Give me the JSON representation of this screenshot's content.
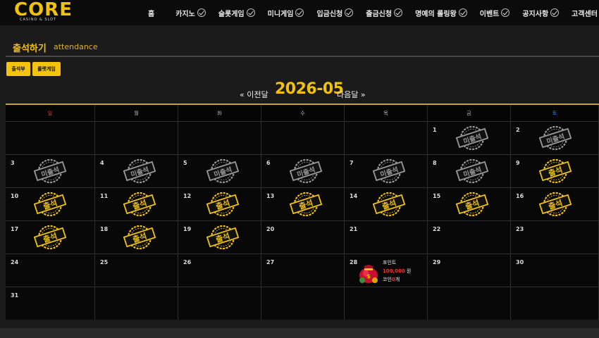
{
  "header": {
    "logo_text": "CORE",
    "logo_sub": "CASINO & SLOT",
    "nav": [
      {
        "label": "홈",
        "check": false,
        "gap": 0
      },
      {
        "label": "카지노",
        "check": true
      },
      {
        "label": "슬롯게임",
        "check": true
      },
      {
        "label": "미니게임",
        "check": true
      },
      {
        "label": "입금신청",
        "check": true
      },
      {
        "label": "출금신청",
        "check": true
      },
      {
        "label": "명예의 롤링왕",
        "check": true
      },
      {
        "label": "이벤트",
        "check": true
      },
      {
        "label": "공지사항",
        "check": true
      },
      {
        "label": "고객센터",
        "check": true
      }
    ]
  },
  "page": {
    "title": "출석하기",
    "subtitle": "attendance",
    "buttons": [
      "출석부",
      "룰렛게임"
    ]
  },
  "month_nav": {
    "prev": "« 이전달",
    "month": "2026-05",
    "next": "다음달 »"
  },
  "calendar": {
    "weekdays": [
      {
        "label": "일",
        "color": "#ff2a2a"
      },
      {
        "label": "월",
        "color": "#bbbbbb"
      },
      {
        "label": "화",
        "color": "#bbbbbb"
      },
      {
        "label": "수",
        "color": "#bbbbbb"
      },
      {
        "label": "목",
        "color": "#bbbbbb"
      },
      {
        "label": "금",
        "color": "#bbbbbb"
      },
      {
        "label": "토",
        "color": "#3a7bff"
      }
    ],
    "stamp_labels": {
      "present": "출석",
      "absent": "미출석"
    },
    "colors": {
      "present": "#f0c20a",
      "absent": "#9a9a9a"
    },
    "weeks": [
      [
        null,
        null,
        null,
        null,
        null,
        {
          "day": "1",
          "status": "absent"
        },
        {
          "day": "2",
          "status": "absent"
        }
      ],
      [
        {
          "day": "3",
          "status": "absent"
        },
        {
          "day": "4",
          "status": "absent"
        },
        {
          "day": "5",
          "status": "absent"
        },
        {
          "day": "6",
          "status": "absent"
        },
        {
          "day": "7",
          "status": "absent"
        },
        {
          "day": "8",
          "status": "absent"
        },
        {
          "day": "9",
          "status": "present"
        }
      ],
      [
        {
          "day": "10",
          "status": "present"
        },
        {
          "day": "11",
          "status": "present"
        },
        {
          "day": "12",
          "status": "present"
        },
        {
          "day": "13",
          "status": "present"
        },
        {
          "day": "14",
          "status": "present"
        },
        {
          "day": "15",
          "status": "present"
        },
        {
          "day": "16",
          "status": "present"
        }
      ],
      [
        {
          "day": "17",
          "status": "present"
        },
        {
          "day": "18",
          "status": "present"
        },
        {
          "day": "19",
          "status": "present"
        },
        {
          "day": "20",
          "status": ""
        },
        {
          "day": "21",
          "status": ""
        },
        {
          "day": "22",
          "status": ""
        },
        {
          "day": "23",
          "status": ""
        }
      ],
      [
        {
          "day": "24",
          "status": ""
        },
        {
          "day": "25",
          "status": ""
        },
        {
          "day": "26",
          "status": ""
        },
        {
          "day": "27",
          "status": ""
        },
        {
          "day": "28",
          "status": "reward"
        },
        {
          "day": "29",
          "status": ""
        },
        {
          "day": "30",
          "status": ""
        }
      ],
      [
        {
          "day": "31",
          "status": ""
        },
        null,
        null,
        null,
        null,
        null,
        null
      ]
    ],
    "reward": {
      "label": "포인트",
      "amount": "100,000",
      "unit": "원",
      "coin_prefix": "코인",
      "coin_count": "0",
      "coin_suffix": "개",
      "icon": "money-bag-icon"
    }
  }
}
